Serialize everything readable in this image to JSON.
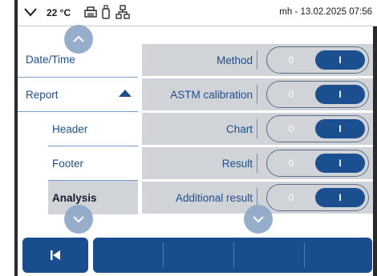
{
  "status": {
    "temperature": "22 °C",
    "datetime": "mh - 13.02.2025 07:56",
    "icons": [
      "chevron-down-icon",
      "printer-icon",
      "usb-drive-icon",
      "network-icon"
    ]
  },
  "nav": {
    "items": [
      {
        "label": "Date/Time"
      },
      {
        "label": "Report",
        "expanded": true
      },
      {
        "label": "Header"
      },
      {
        "label": "Footer"
      },
      {
        "label": "Analysis",
        "selected": true
      }
    ]
  },
  "settings": {
    "rows": [
      {
        "label": "Method",
        "off_label": "0",
        "on_label": "I",
        "value": "on"
      },
      {
        "label": "ASTM calibration",
        "off_label": "0",
        "on_label": "I",
        "value": "on"
      },
      {
        "label": "Chart",
        "off_label": "0",
        "on_label": "I",
        "value": "on"
      },
      {
        "label": "Result",
        "off_label": "0",
        "on_label": "I",
        "value": "on"
      },
      {
        "label": "Additional result",
        "off_label": "0",
        "on_label": "I",
        "value": "on"
      }
    ]
  },
  "colors": {
    "accent": "#1a4d8d",
    "row_bg": "#d0d3d8",
    "label_text": "#1f4e8c",
    "scroll_button": "#8fa8c6"
  },
  "bottom": {
    "back_icon": "skip-back-icon",
    "buttons": [
      "",
      "",
      "",
      ""
    ]
  }
}
